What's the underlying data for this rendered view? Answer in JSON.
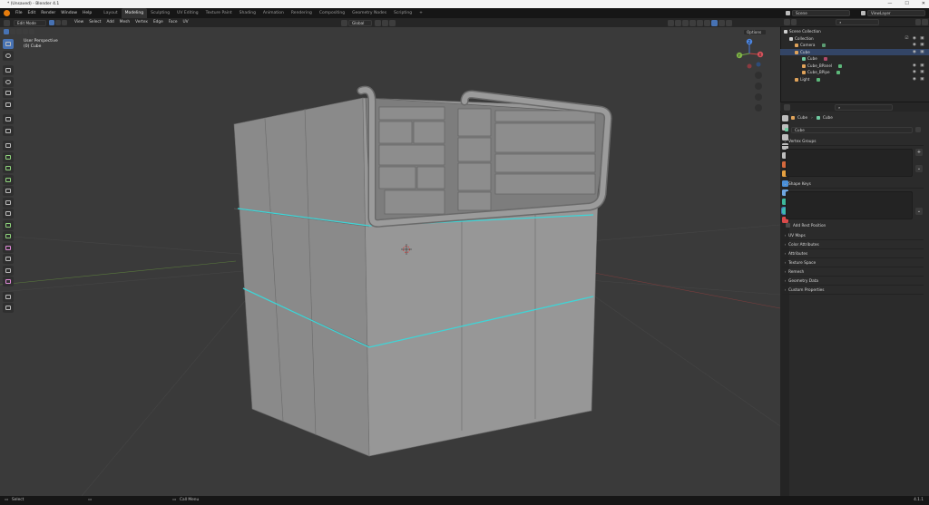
{
  "window": {
    "title": "* (Unsaved) - Blender 4.1",
    "controls": [
      "—",
      "☐",
      "✕"
    ]
  },
  "menu": [
    "File",
    "Edit",
    "Render",
    "Window",
    "Help"
  ],
  "workspaces": [
    "Layout",
    "Modeling",
    "Sculpting",
    "UV Editing",
    "Texture Paint",
    "Shading",
    "Animation",
    "Rendering",
    "Compositing",
    "Geometry Nodes",
    "Scripting"
  ],
  "workspaces_active": "Modeling",
  "add_workspace": "+",
  "scene": {
    "label": "Scene",
    "view_layer": "ViewLayer"
  },
  "viewport_header": {
    "mode": "Edit Mode",
    "menus": [
      "View",
      "Select",
      "Add",
      "Mesh",
      "Vertex",
      "Edge",
      "Face",
      "UV"
    ],
    "transform_orientation": "Global",
    "options_label": "Options"
  },
  "viewport_info": {
    "line1": "User Perspective",
    "line2": "(0) Cube"
  },
  "axis_labels": {
    "x": "X",
    "y": "Y",
    "z": "Z"
  },
  "outliner": {
    "title": "Scene Collection",
    "rows": [
      {
        "label": "Collection",
        "indent": 1,
        "color": "#cfcfcf"
      },
      {
        "label": "Camera",
        "indent": 2,
        "color": "#e0a35a"
      },
      {
        "label": "Cube",
        "indent": 2,
        "color": "#e0a35a"
      },
      {
        "label": "Cube",
        "indent": 3,
        "color": "#6fc9a0"
      },
      {
        "label": "Cube_BPanel",
        "indent": 3,
        "color": "#e0a35a"
      },
      {
        "label": "Cube_BPipe",
        "indent": 3,
        "color": "#e0a35a"
      },
      {
        "label": "Light",
        "indent": 2,
        "color": "#e0a35a"
      }
    ]
  },
  "properties": {
    "breadcrumb_object": "Cube",
    "breadcrumb_data": "Cube",
    "data_name": "Cube",
    "sections": {
      "vertex_groups": "Vertex Groups",
      "shape_keys": "Shape Keys",
      "add_rest_position": "Add Rest Position",
      "uv_maps": "UV Maps",
      "color_attributes": "Color Attributes",
      "attributes": "Attributes",
      "texture_space": "Texture Space",
      "remesh": "Remesh",
      "geometry_data": "Geometry Data",
      "custom_properties": "Custom Properties"
    },
    "tab_colors": [
      "#bdbdbd",
      "#bdbdbd",
      "#bdbdbd",
      "#bdbdbd",
      "#bdbdbd",
      "#d3683d",
      "#e6a040",
      "#4a8fd9",
      "#6fa6e0",
      "#3db89c",
      "#3db8b0",
      "#d94a4a"
    ]
  },
  "statusbar": {
    "left": "Select",
    "middle": "Call Menu",
    "version": "4.1.1"
  },
  "colors": {
    "accent": "#4772b3",
    "edge_highlight": "#3fd4d6",
    "viewport": "#3a3a3a",
    "mesh": "#8f8f8f"
  }
}
